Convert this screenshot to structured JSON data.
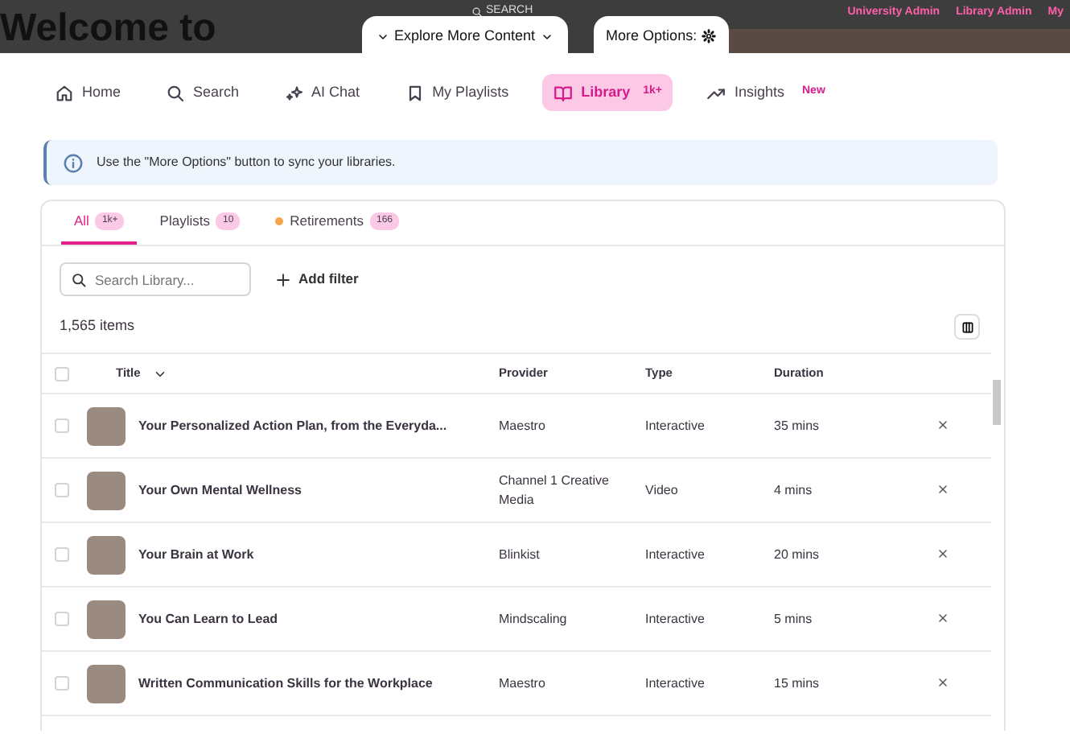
{
  "header": {
    "search_label": "SEARCH",
    "admin_links": [
      "University Admin",
      "Library Admin",
      "My"
    ],
    "hero_title": "Welcome to"
  },
  "floating_tabs": [
    {
      "label": "Explore More Content",
      "kind": "dropdown"
    },
    {
      "label": "More Options:",
      "kind": "settings"
    }
  ],
  "nav": [
    {
      "label": "Home",
      "selected": false
    },
    {
      "label": "Search",
      "selected": false
    },
    {
      "label": "AI Chat",
      "selected": false
    },
    {
      "label": "My Playlists",
      "selected": false
    },
    {
      "label": "Library",
      "selected": true,
      "badge": "1k+"
    },
    {
      "label": "Insights",
      "selected": false,
      "badge": "New"
    }
  ],
  "alert": "Use the \"More Options\" button to sync your libraries.",
  "tabs": [
    {
      "label": "All",
      "count": "1k+",
      "selected": true
    },
    {
      "label": "Playlists",
      "count": "10",
      "selected": false
    },
    {
      "label": "Retirements",
      "count": "166",
      "selected": false,
      "color": "#f5a54a"
    }
  ],
  "search": {
    "placeholder": "Search Library..."
  },
  "add_filter": "Add filter",
  "item_count": "1,565 items",
  "table": {
    "select_all_checked": false,
    "columns": [
      "Title",
      "Provider",
      "Type",
      "Duration"
    ],
    "rows": [
      {
        "title": "Your Personalized Action Plan, from the Everyda...",
        "provider": "Maestro",
        "type": "Interactive",
        "duration": "35 mins",
        "checked": false
      },
      {
        "title": "Your Own Mental Wellness",
        "provider": "Channel 1 Creative Media",
        "type": "Video",
        "duration": "4 mins",
        "checked": false
      },
      {
        "title": "Your Brain at Work",
        "provider": "Blinkist",
        "type": "Interactive",
        "duration": "20 mins",
        "checked": false
      },
      {
        "title": "You Can Learn to Lead",
        "provider": "Mindscaling",
        "type": "Interactive",
        "duration": "5 mins",
        "checked": false
      },
      {
        "title": "Written Communication Skills for the Workplace",
        "provider": "Maestro",
        "type": "Interactive",
        "duration": "15 mins",
        "checked": false
      }
    ]
  }
}
